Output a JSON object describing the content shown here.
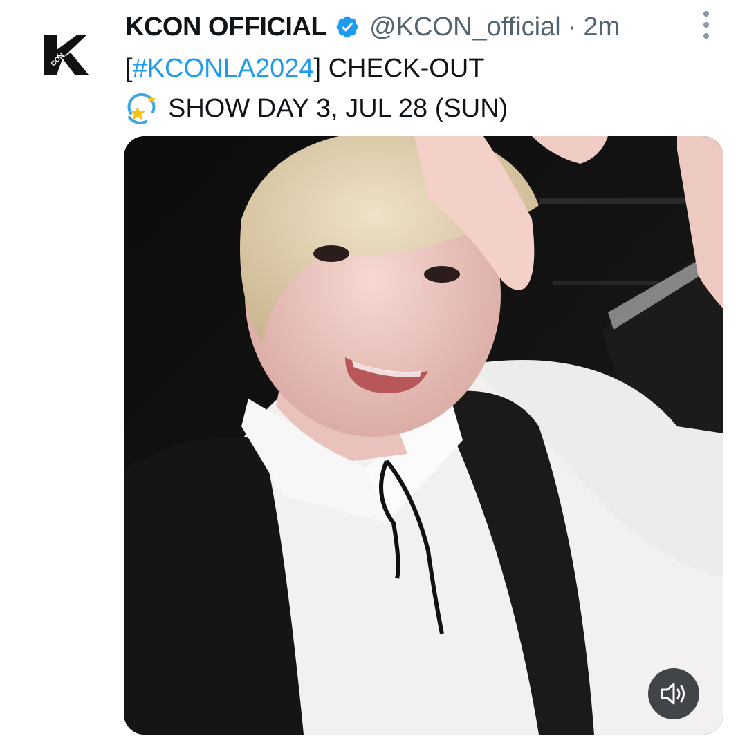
{
  "tweet": {
    "author": {
      "display_name": "KCON OFFICIAL",
      "handle": "@KCON_official",
      "logo_text": "CON",
      "verified": true
    },
    "separator": "·",
    "timestamp": "2m",
    "text": {
      "open_bracket": "[",
      "hashtag": "#KCONLA2024",
      "after_hashtag": "] CHECK-OUT",
      "line2_emoji": "dizzy-star-emoji",
      "line2": "SHOW DAY 3, JUL 28 (SUN)"
    },
    "media": {
      "type": "video",
      "sound_icon": "volume-icon"
    },
    "more_icon": "more-vertical-icon"
  },
  "colors": {
    "text": "#0f1419",
    "secondary": "#536471",
    "link": "#1d9bf0",
    "verified_badge": "#1d9bf0"
  }
}
